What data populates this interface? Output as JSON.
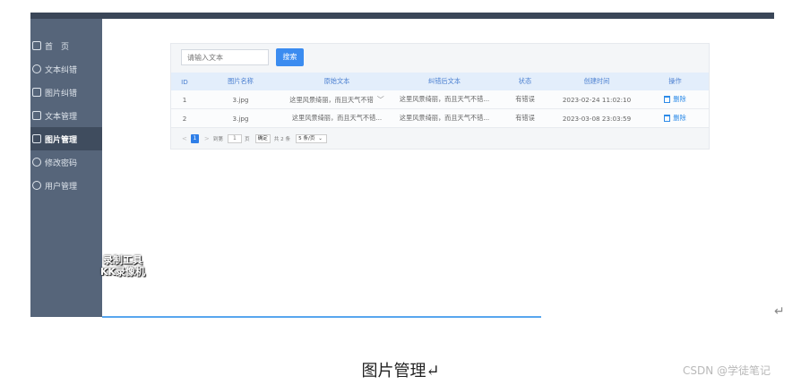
{
  "sidebar": {
    "items": [
      {
        "label": "首　页",
        "icon": "home-icon"
      },
      {
        "label": "文本纠错",
        "icon": "layers-icon"
      },
      {
        "label": "图片纠错",
        "icon": "home-icon"
      },
      {
        "label": "文本管理",
        "icon": "home-icon"
      },
      {
        "label": "图片管理",
        "icon": "home-icon",
        "active": true
      },
      {
        "label": "修改密码",
        "icon": "gear-icon"
      },
      {
        "label": "用户管理",
        "icon": "user-icon"
      }
    ]
  },
  "watermark": {
    "line1": "录制工具",
    "line2": "KK录像机"
  },
  "search": {
    "placeholder": "请输入文本",
    "button_label": "搜索"
  },
  "table": {
    "headers": [
      "ID",
      "图片名称",
      "原始文本",
      "纠错后文本",
      "状态",
      "创建时间",
      "操作"
    ],
    "rows": [
      {
        "id": "1",
        "name": "3.jpg",
        "original": "这里风景绮丽，而且天气不错",
        "corrected": "这里风景绮丽，而且天气不错...",
        "status": "有错误",
        "created": "2023-02-24 11:02:10",
        "action": "删除"
      },
      {
        "id": "2",
        "name": "3.jpg",
        "original": "这里风景绮丽，而且天气不错...",
        "corrected": "这里风景绮丽，而且天气不错...",
        "status": "有错误",
        "created": "2023-03-08 23:03:59",
        "action": "删除"
      }
    ]
  },
  "pager": {
    "prev": "<",
    "current": "1",
    "next": ">",
    "goto_label": "到第",
    "goto_value": "1",
    "page_unit": "页",
    "confirm": "确定",
    "total": "共 2 条",
    "page_size": "5 条/页"
  },
  "caption": "图片管理↵",
  "csdn": "CSDN @学徒笔记",
  "return_mark": "↵"
}
